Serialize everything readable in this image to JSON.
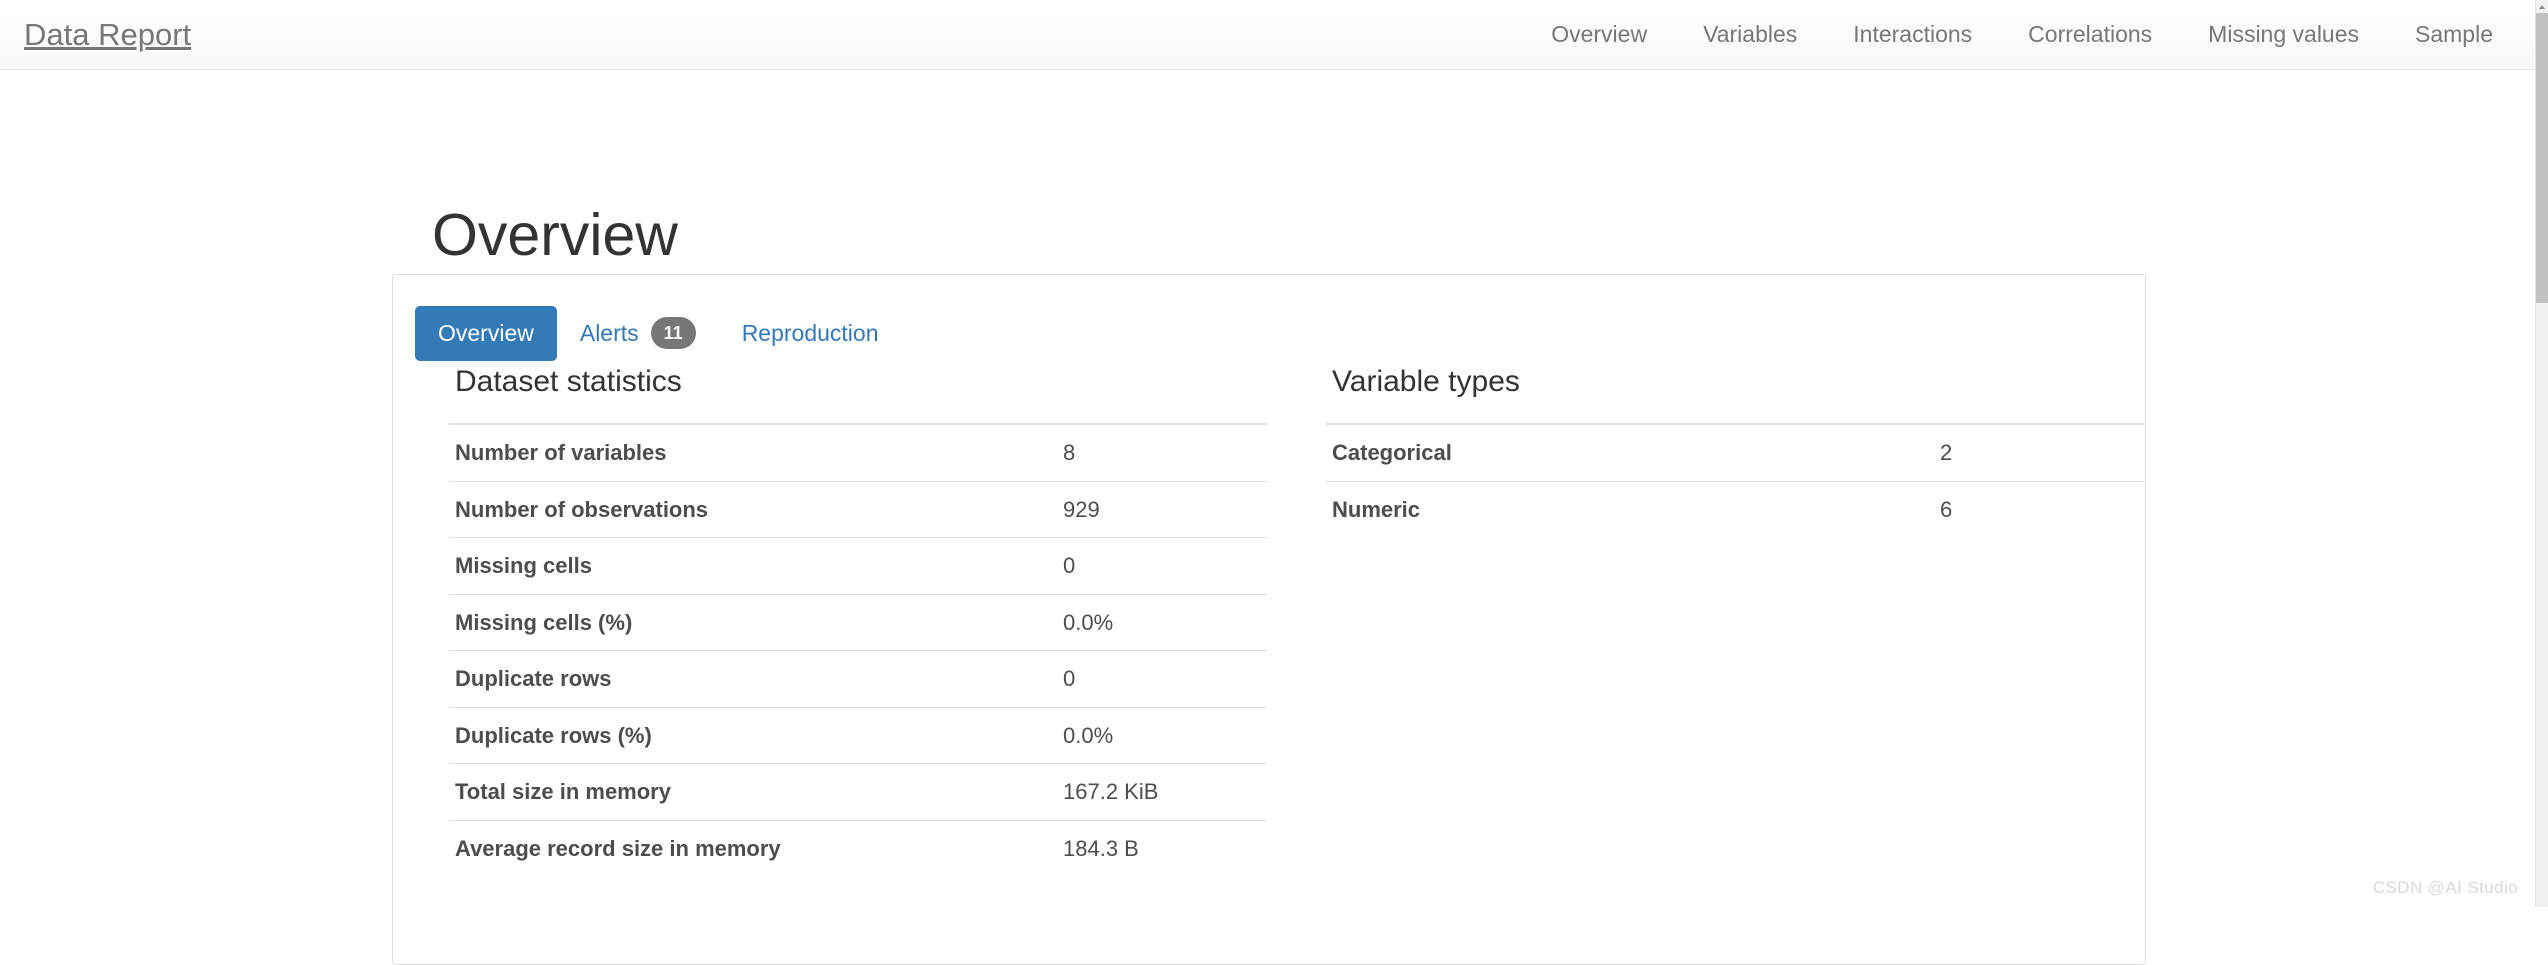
{
  "navbar": {
    "brand": "Data Report",
    "links": [
      {
        "label": "Overview"
      },
      {
        "label": "Variables"
      },
      {
        "label": "Interactions"
      },
      {
        "label": "Correlations"
      },
      {
        "label": "Missing values"
      },
      {
        "label": "Sample"
      }
    ]
  },
  "page": {
    "title": "Overview"
  },
  "tabs": [
    {
      "label": "Overview",
      "badge": null,
      "active": true
    },
    {
      "label": "Alerts",
      "badge": "11",
      "active": false
    },
    {
      "label": "Reproduction",
      "badge": null,
      "active": false
    }
  ],
  "panels": [
    {
      "title": "Dataset statistics",
      "rows": [
        {
          "key": "Number of variables",
          "value": "8"
        },
        {
          "key": "Number of observations",
          "value": "929"
        },
        {
          "key": "Missing cells",
          "value": "0"
        },
        {
          "key": "Missing cells (%)",
          "value": "0.0%"
        },
        {
          "key": "Duplicate rows",
          "value": "0"
        },
        {
          "key": "Duplicate rows (%)",
          "value": "0.0%"
        },
        {
          "key": "Total size in memory",
          "value": "167.2 KiB"
        },
        {
          "key": "Average record size in memory",
          "value": "184.3 B"
        }
      ]
    },
    {
      "title": "Variable types",
      "rows": [
        {
          "key": "Categorical",
          "value": "2"
        },
        {
          "key": "Numeric",
          "value": "6"
        }
      ]
    }
  ],
  "watermark": "CSDN @AI Studio",
  "colors": {
    "accent": "#337ab7",
    "badge": "#777777",
    "text": "#4d4d4d",
    "muted": "#777777",
    "border": "#dddddd"
  }
}
